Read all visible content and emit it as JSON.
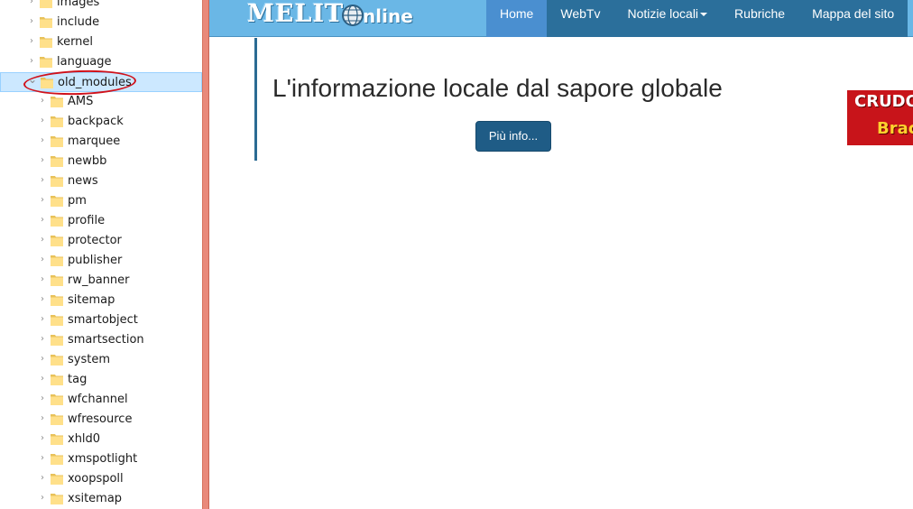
{
  "explorer": {
    "items": [
      {
        "label": "images",
        "level": 0,
        "expanded": false
      },
      {
        "label": "include",
        "level": 0,
        "expanded": false
      },
      {
        "label": "kernel",
        "level": 0,
        "expanded": false
      },
      {
        "label": "language",
        "level": 0,
        "expanded": false
      },
      {
        "label": "old_modules",
        "level": 0,
        "expanded": true,
        "selected": true
      },
      {
        "label": "AMS",
        "level": 1
      },
      {
        "label": "backpack",
        "level": 1
      },
      {
        "label": "marquee",
        "level": 1
      },
      {
        "label": "newbb",
        "level": 1
      },
      {
        "label": "news",
        "level": 1
      },
      {
        "label": "pm",
        "level": 1
      },
      {
        "label": "profile",
        "level": 1
      },
      {
        "label": "protector",
        "level": 1
      },
      {
        "label": "publisher",
        "level": 1
      },
      {
        "label": "rw_banner",
        "level": 1
      },
      {
        "label": "sitemap",
        "level": 1
      },
      {
        "label": "smartobject",
        "level": 1
      },
      {
        "label": "smartsection",
        "level": 1
      },
      {
        "label": "system",
        "level": 1
      },
      {
        "label": "tag",
        "level": 1
      },
      {
        "label": "wfchannel",
        "level": 1
      },
      {
        "label": "wfresource",
        "level": 1
      },
      {
        "label": "xhld0",
        "level": 1
      },
      {
        "label": "xmspotlight",
        "level": 1
      },
      {
        "label": "xoopspoll",
        "level": 1
      },
      {
        "label": "xsitemap",
        "level": 1
      }
    ],
    "annotation_color": "#d0121b"
  },
  "site": {
    "logo": {
      "main": "MELIT",
      "sub": "nline"
    },
    "nav": [
      {
        "label": "Home",
        "active": true,
        "dropdown": false
      },
      {
        "label": "WebTv",
        "active": false,
        "dropdown": false
      },
      {
        "label": "Notizie locali",
        "active": false,
        "dropdown": true
      },
      {
        "label": "Rubriche",
        "active": false,
        "dropdown": false
      },
      {
        "label": "Mappa del sito",
        "active": false,
        "dropdown": false
      }
    ],
    "hero": {
      "title": "L'informazione locale dal sapore globale",
      "button_label": "Più info..."
    },
    "banner": {
      "line1": "CRUDO,",
      "line2": "Brace"
    },
    "colors": {
      "header": "#6ab7e6",
      "nav": "#2b6f9b",
      "nav_active": "#4a8fd0",
      "button": "#1f5c86",
      "banner": "#c8141a"
    }
  }
}
